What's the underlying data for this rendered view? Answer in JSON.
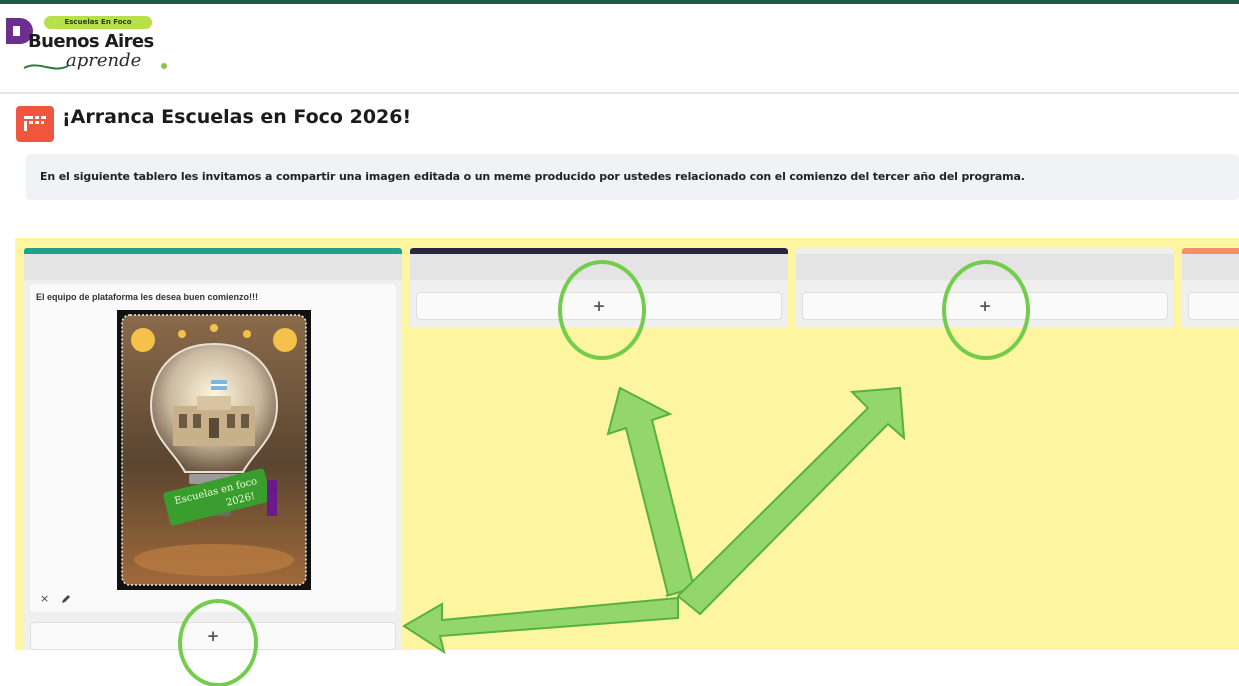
{
  "header": {
    "logo_pill_text": "Escuelas En Foco",
    "logo_main_text": "Buenos Aires",
    "logo_sub_text": "aprende"
  },
  "page": {
    "title": "¡Arranca Escuelas en Foco 2026!",
    "description": "En el siguiente tablero les invitamos a compartir una imagen editada o un meme producido por ustedes relacionado con el comienzo del tercer año del programa."
  },
  "board": {
    "background_color": "#fdf59f",
    "columns": [
      {
        "accent_color": "#1ea38a",
        "add_label": "+",
        "posts": [
          {
            "text": "El equipo de plataforma les desea buen comienzo!!!",
            "image_caption_line1": "Escuelas en foco",
            "image_caption_line2": "2026!",
            "delete_label": "×"
          }
        ]
      },
      {
        "accent_color": "#2a2640",
        "add_label": "+"
      },
      {
        "accent_color": "#fdf59f",
        "add_label": "+"
      },
      {
        "accent_color": "#f59066",
        "add_label": ""
      }
    ]
  },
  "annotations": {
    "color": "#74cc4c"
  },
  "icons": {
    "logo": "dashboard-logo-icon",
    "title": "board-grid-icon",
    "edit": "pencil-icon",
    "delete": "close-icon"
  }
}
